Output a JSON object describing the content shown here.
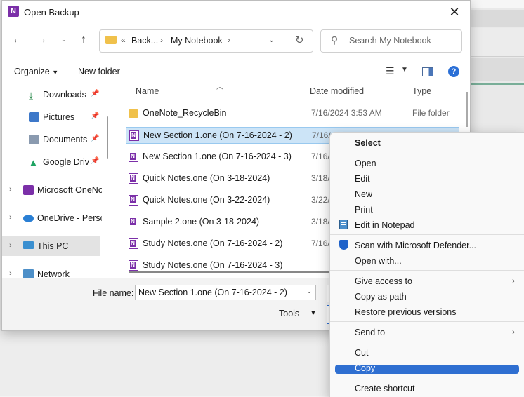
{
  "dialog": {
    "title": "Open Backup",
    "app_icon_letter": "N"
  },
  "nav": {
    "breadcrumb": {
      "prefix": "«",
      "items": [
        "Back...",
        "My Notebook"
      ]
    },
    "search_placeholder": "Search My Notebook"
  },
  "toolbar": {
    "organize": "Organize",
    "new_folder": "New folder",
    "help": "?"
  },
  "sidebar": {
    "items": [
      {
        "label": "Downloads"
      },
      {
        "label": "Pictures"
      },
      {
        "label": "Documents"
      },
      {
        "label": "Google Drive"
      },
      {
        "label": "Microsoft OneNote"
      },
      {
        "label": "OneDrive - Personal"
      },
      {
        "label": "This PC"
      },
      {
        "label": "Network"
      }
    ]
  },
  "columns": {
    "name": "Name",
    "date": "Date modified",
    "type": "Type"
  },
  "files": [
    {
      "name": "OneNote_RecycleBin",
      "date": "7/16/2024 3:53 AM",
      "type": "File folder"
    },
    {
      "name": "New Section 1.one (On 7-16-2024 - 2)",
      "date": "7/16/"
    },
    {
      "name": "New Section 1.one (On 7-16-2024 - 3)",
      "date": "7/16/"
    },
    {
      "name": "Quick Notes.one (On 3-18-2024)",
      "date": "3/18/"
    },
    {
      "name": "Quick Notes.one (On 3-22-2024)",
      "date": "3/22/"
    },
    {
      "name": "Sample 2.one (On 3-18-2024)",
      "date": "3/18/"
    },
    {
      "name": "Study Notes.one (On 7-16-2024 - 2)",
      "date": "7/16/"
    },
    {
      "name": "Study Notes.one (On 7-16-2024 - 3)",
      "date": ""
    }
  ],
  "footer": {
    "file_name_label": "File name:",
    "file_name_value": "New Section 1.one (On 7-16-2024 - 2)",
    "tools": "Tools"
  },
  "context_menu": {
    "select": "Select",
    "open": "Open",
    "edit": "Edit",
    "new": "New",
    "print": "Print",
    "edit_notepad": "Edit in Notepad",
    "scan": "Scan with Microsoft Defender...",
    "open_with": "Open with...",
    "give_access": "Give access to",
    "copy_path": "Copy as path",
    "restore": "Restore previous versions",
    "send_to": "Send to",
    "cut": "Cut",
    "copy": "Copy",
    "create_shortcut": "Create shortcut"
  }
}
